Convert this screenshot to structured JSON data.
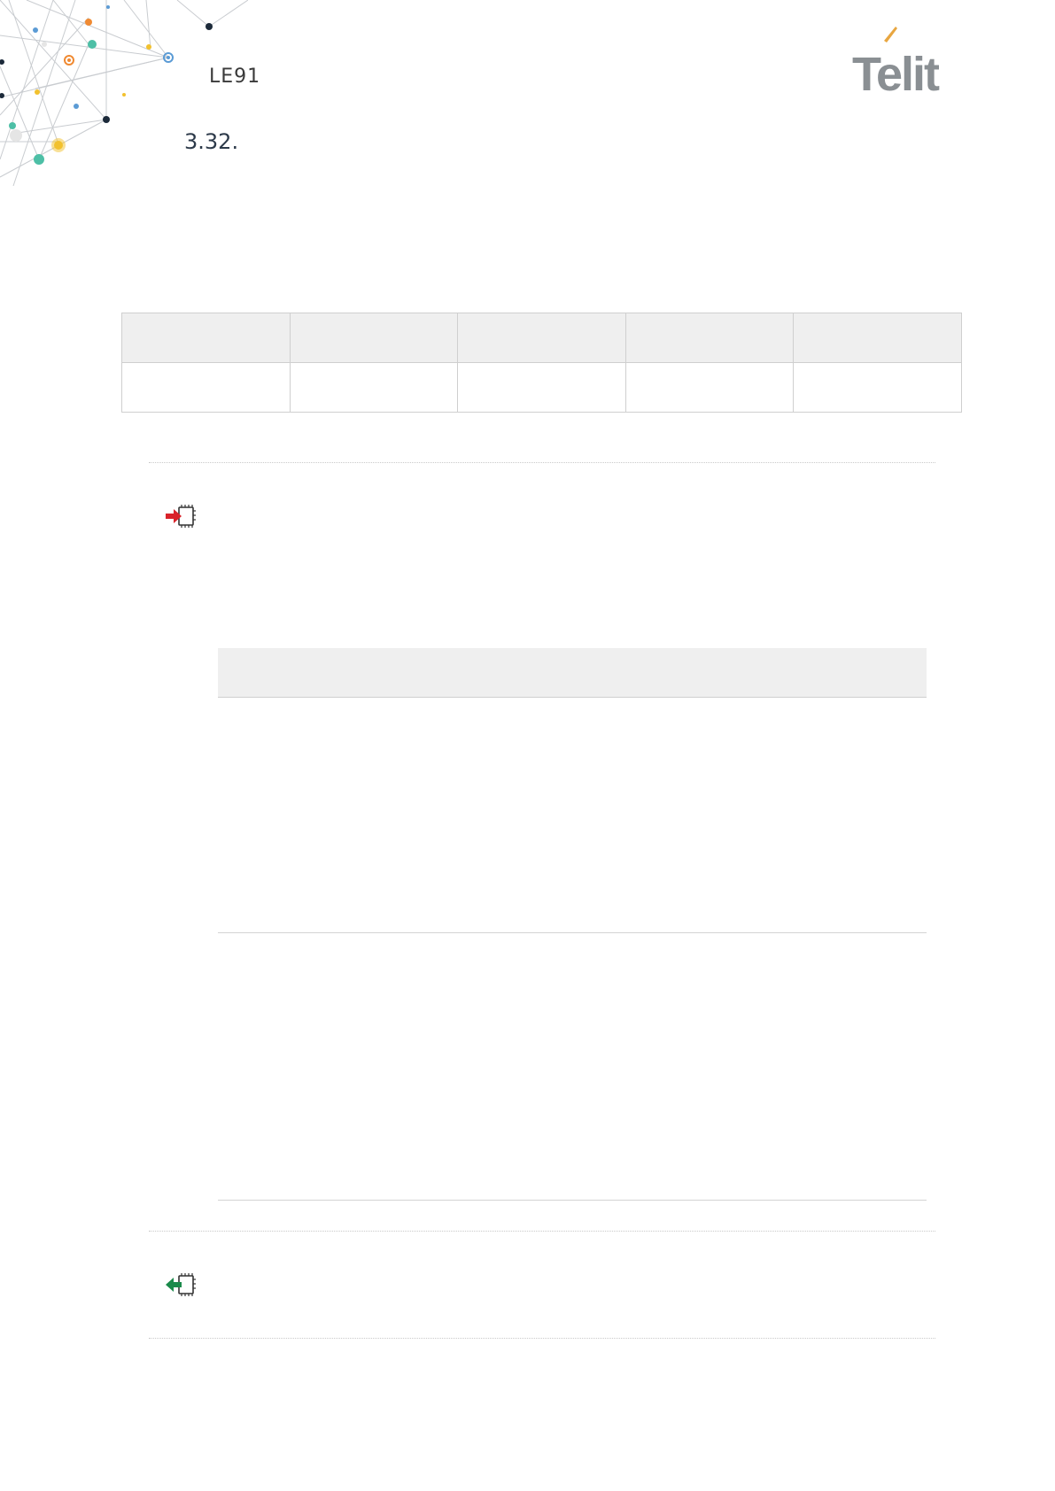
{
  "header": {
    "model": "LE91",
    "section_number": "3.32."
  },
  "logo": {
    "text": "Telit",
    "accent_color": "#e8a640",
    "text_color": "#8a8f93"
  },
  "icons": {
    "set_command": "set-command-icon",
    "read_command": "read-command-icon"
  },
  "colors": {
    "set_arrow": "#d9232a",
    "read_arrow": "#1b8a4b",
    "table_header_bg": "#efefef"
  }
}
